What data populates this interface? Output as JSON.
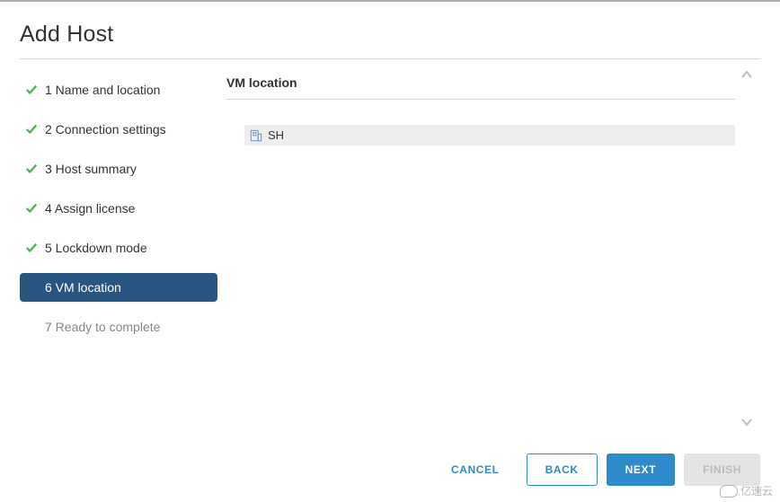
{
  "dialog": {
    "title": "Add Host"
  },
  "steps": [
    {
      "label": "1 Name and location",
      "state": "done"
    },
    {
      "label": "2 Connection settings",
      "state": "done"
    },
    {
      "label": "3 Host summary",
      "state": "done"
    },
    {
      "label": "4 Assign license",
      "state": "done"
    },
    {
      "label": "5 Lockdown mode",
      "state": "done"
    },
    {
      "label": "6 VM location",
      "state": "active"
    },
    {
      "label": "7 Ready to complete",
      "state": "pending"
    }
  ],
  "main": {
    "section_title": "VM location",
    "tree": {
      "selected_label": "SH"
    }
  },
  "footer": {
    "cancel": "CANCEL",
    "back": "BACK",
    "next": "NEXT",
    "finish": "FINISH"
  },
  "watermark": "亿速云"
}
